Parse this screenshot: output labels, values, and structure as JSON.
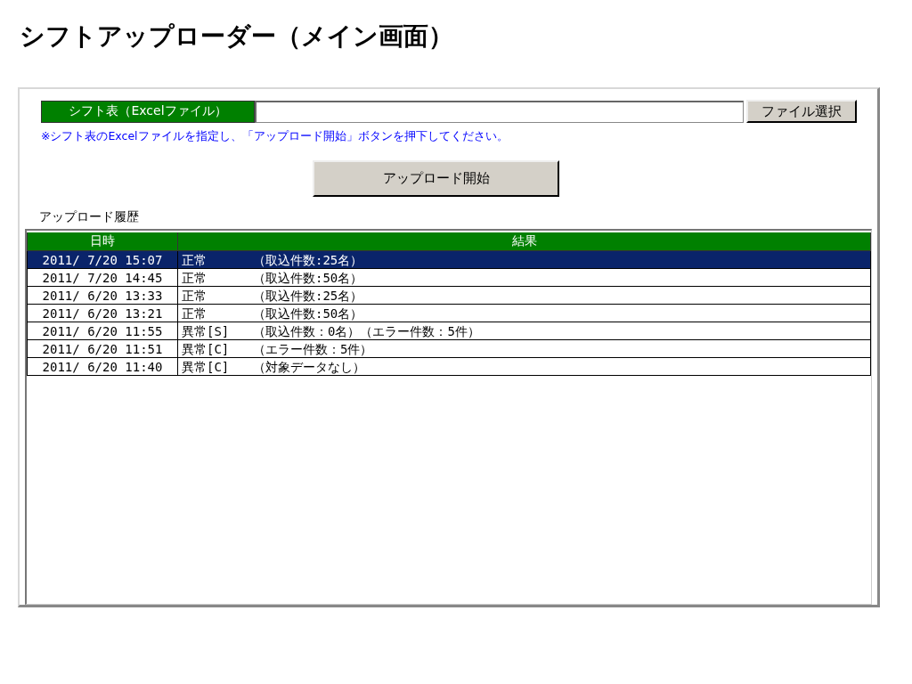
{
  "page_title": "シフトアップローダー（メイン画面）",
  "file_field": {
    "label": "シフト表（Excelファイル）"
  },
  "select_button": "ファイル選択",
  "note": "※シフト表のExcelファイルを指定し、「アップロード開始」ボタンを押下してください。",
  "upload_button": "アップロード開始",
  "history_label": "アップロード履歴",
  "table": {
    "columns": [
      "日時",
      "結果"
    ],
    "rows": [
      {
        "datetime": "2011/ 7/20 15:07",
        "status": "正常",
        "detail": "（取込件数:25名）",
        "selected": true
      },
      {
        "datetime": "2011/ 7/20 14:45",
        "status": "正常",
        "detail": "（取込件数:50名）",
        "selected": false
      },
      {
        "datetime": "2011/ 6/20 13:33",
        "status": "正常",
        "detail": "（取込件数:25名）",
        "selected": false
      },
      {
        "datetime": "2011/ 6/20 13:21",
        "status": "正常",
        "detail": "（取込件数:50名）",
        "selected": false
      },
      {
        "datetime": "2011/ 6/20 11:55",
        "status": "異常[S]",
        "detail": "（取込件数：0名）（エラー件数：5件）",
        "selected": false
      },
      {
        "datetime": "2011/ 6/20 11:51",
        "status": "異常[C]",
        "detail": "（エラー件数：5件）",
        "selected": false
      },
      {
        "datetime": "2011/ 6/20 11:40",
        "status": "異常[C]",
        "detail": "（対象データなし）",
        "selected": false
      }
    ]
  }
}
